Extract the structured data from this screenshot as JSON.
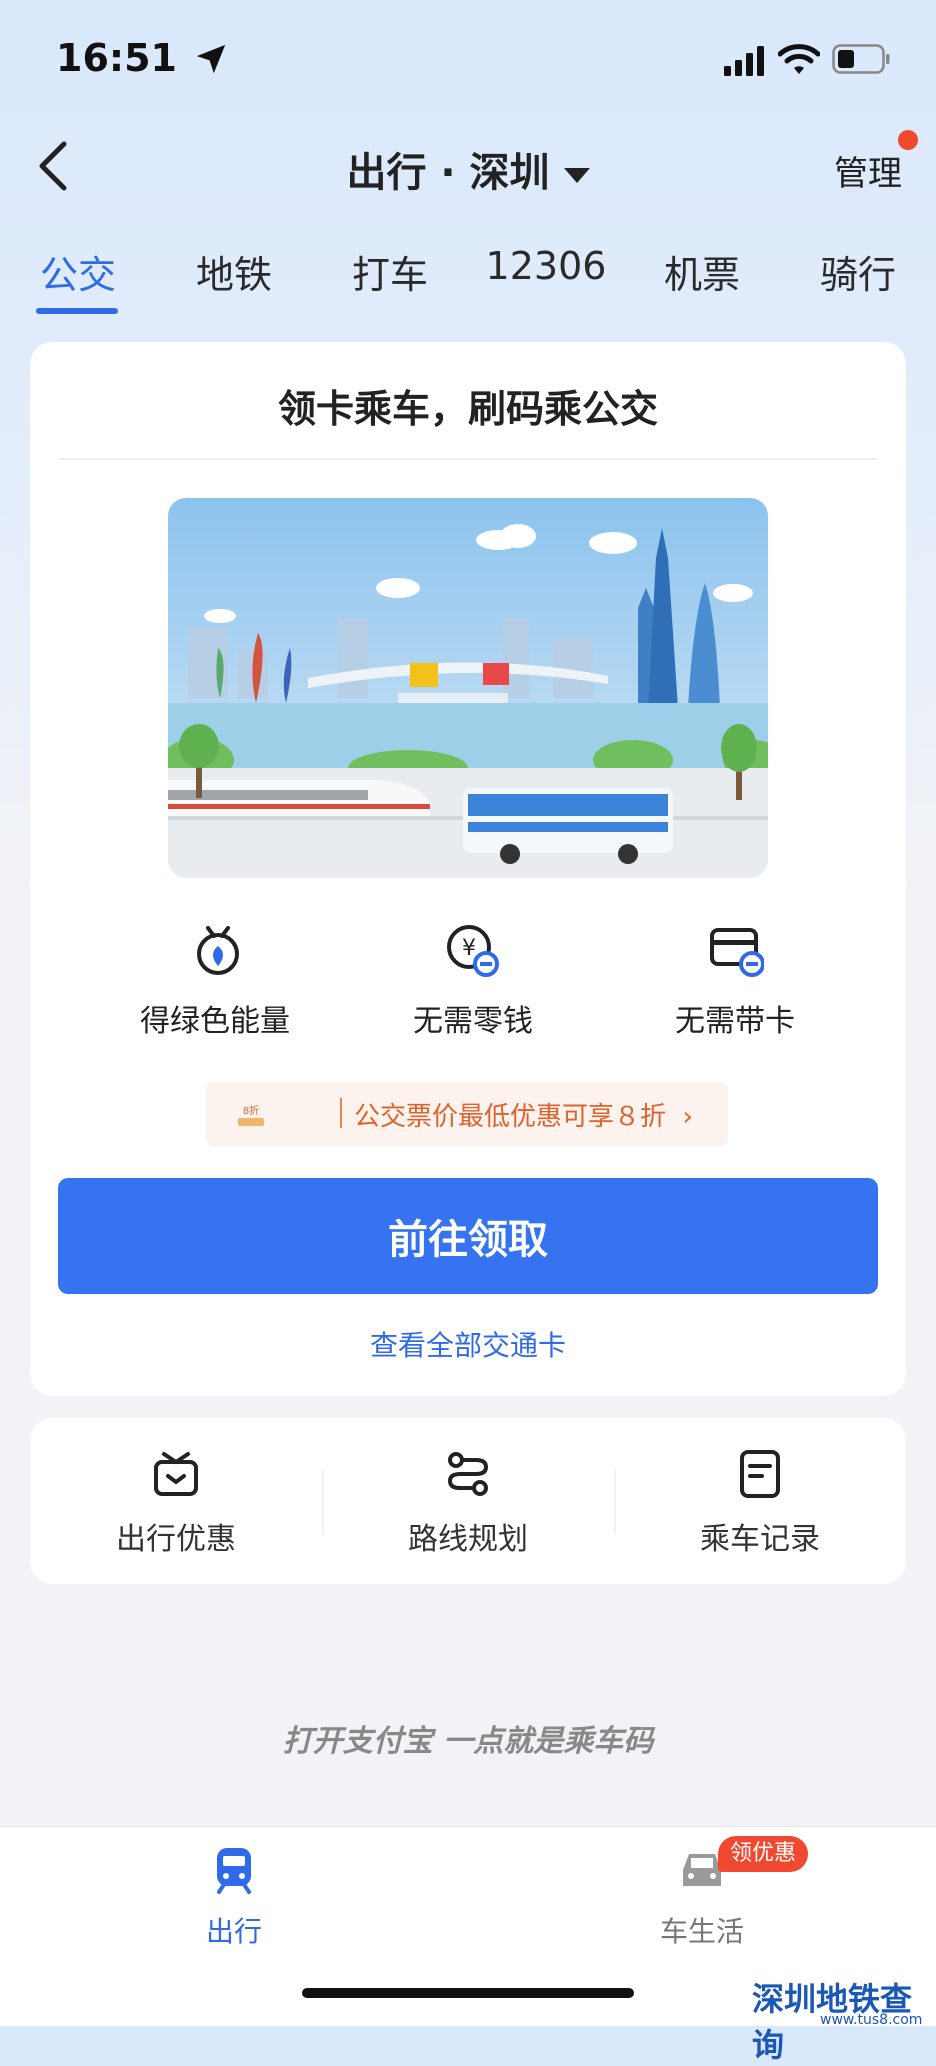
{
  "status": {
    "time": "16:51"
  },
  "nav": {
    "title": "出行 · 深圳",
    "manage": "管理"
  },
  "tabs": [
    {
      "label": "公交",
      "active": true
    },
    {
      "label": "地铁",
      "active": false
    },
    {
      "label": "打车",
      "active": false
    },
    {
      "label": "12306",
      "active": false
    },
    {
      "label": "机票",
      "active": false
    },
    {
      "label": "骑行",
      "active": false
    }
  ],
  "card": {
    "title": "领卡乘车，刷码乘公交",
    "features": [
      {
        "icon": "green-energy-icon",
        "label": "得绿色能量"
      },
      {
        "icon": "no-change-icon",
        "label": "无需零钱"
      },
      {
        "icon": "no-card-icon",
        "label": "无需带卡"
      }
    ],
    "promo": {
      "badge": "8折",
      "text": "公交票价最低优惠可享８折",
      "arrow": "›"
    },
    "cta": "前往领取",
    "link": "查看全部交通卡"
  },
  "quick": [
    {
      "icon": "gift-icon",
      "label": "出行优惠"
    },
    {
      "icon": "route-icon",
      "label": "路线规划"
    },
    {
      "icon": "record-icon",
      "label": "乘车记录"
    }
  ],
  "slogan": "打开支付宝 一点就是乘车码",
  "bottom": {
    "items": [
      {
        "icon": "train-icon",
        "label": "出行",
        "active": true
      },
      {
        "icon": "car-icon",
        "label": "车生活",
        "active": false
      }
    ],
    "badge": "领优惠"
  },
  "watermark": {
    "main": "深圳地铁查询",
    "sub": "www.tus8.com"
  },
  "colors": {
    "accent": "#3573f1",
    "promo": "#e0612c",
    "badge": "#f0492f"
  }
}
